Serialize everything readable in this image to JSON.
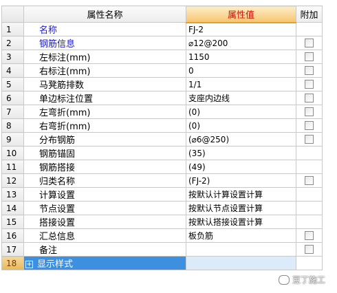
{
  "header": {
    "name": "属性名称",
    "value": "属性值",
    "add": "附加"
  },
  "rows": [
    {
      "num": "1",
      "name": "名称",
      "value": "FJ-2",
      "has_checkbox": false,
      "blue": true
    },
    {
      "num": "2",
      "name": "钢筋信息",
      "value": "⌀12@200",
      "has_checkbox": true,
      "blue": true
    },
    {
      "num": "3",
      "name": "左标注(mm)",
      "value": "1150",
      "has_checkbox": true,
      "blue": false
    },
    {
      "num": "4",
      "name": "右标注(mm)",
      "value": "0",
      "has_checkbox": true,
      "blue": false
    },
    {
      "num": "5",
      "name": "马凳筋排数",
      "value": "1/1",
      "has_checkbox": true,
      "blue": false
    },
    {
      "num": "6",
      "name": "单边标注位置",
      "value": "支座内边线",
      "has_checkbox": true,
      "blue": false
    },
    {
      "num": "7",
      "name": "左弯折(mm)",
      "value": "(0)",
      "has_checkbox": true,
      "blue": false
    },
    {
      "num": "8",
      "name": "右弯折(mm)",
      "value": "(0)",
      "has_checkbox": true,
      "blue": false
    },
    {
      "num": "9",
      "name": "分布钢筋",
      "value": "(⌀6@250)",
      "has_checkbox": true,
      "blue": false
    },
    {
      "num": "10",
      "name": "钢筋锚固",
      "value": "(35)",
      "has_checkbox": false,
      "blue": false
    },
    {
      "num": "11",
      "name": "钢筋搭接",
      "value": "(49)",
      "has_checkbox": false,
      "blue": false
    },
    {
      "num": "12",
      "name": "归类名称",
      "value": "(FJ-2)",
      "has_checkbox": true,
      "blue": false
    },
    {
      "num": "13",
      "name": "计算设置",
      "value": "按默认计算设置计算",
      "has_checkbox": false,
      "blue": false
    },
    {
      "num": "14",
      "name": "节点设置",
      "value": "按默认节点设置计算",
      "has_checkbox": false,
      "blue": false
    },
    {
      "num": "15",
      "name": "搭接设置",
      "value": "按默认搭接设置计算",
      "has_checkbox": false,
      "blue": false
    },
    {
      "num": "16",
      "name": "汇总信息",
      "value": "板负筋",
      "has_checkbox": true,
      "blue": false
    },
    {
      "num": "17",
      "name": "备注",
      "value": "",
      "has_checkbox": true,
      "blue": false
    },
    {
      "num": "18",
      "name": "显示样式",
      "value": "",
      "has_checkbox": false,
      "blue": false,
      "selected": true,
      "expandable": true
    }
  ],
  "watermark": {
    "text": "豆丁施工"
  },
  "colors": {
    "blue_label": "#1a1ad0",
    "header_value_text": "#c8150b",
    "selection": "#3d8fe0"
  }
}
